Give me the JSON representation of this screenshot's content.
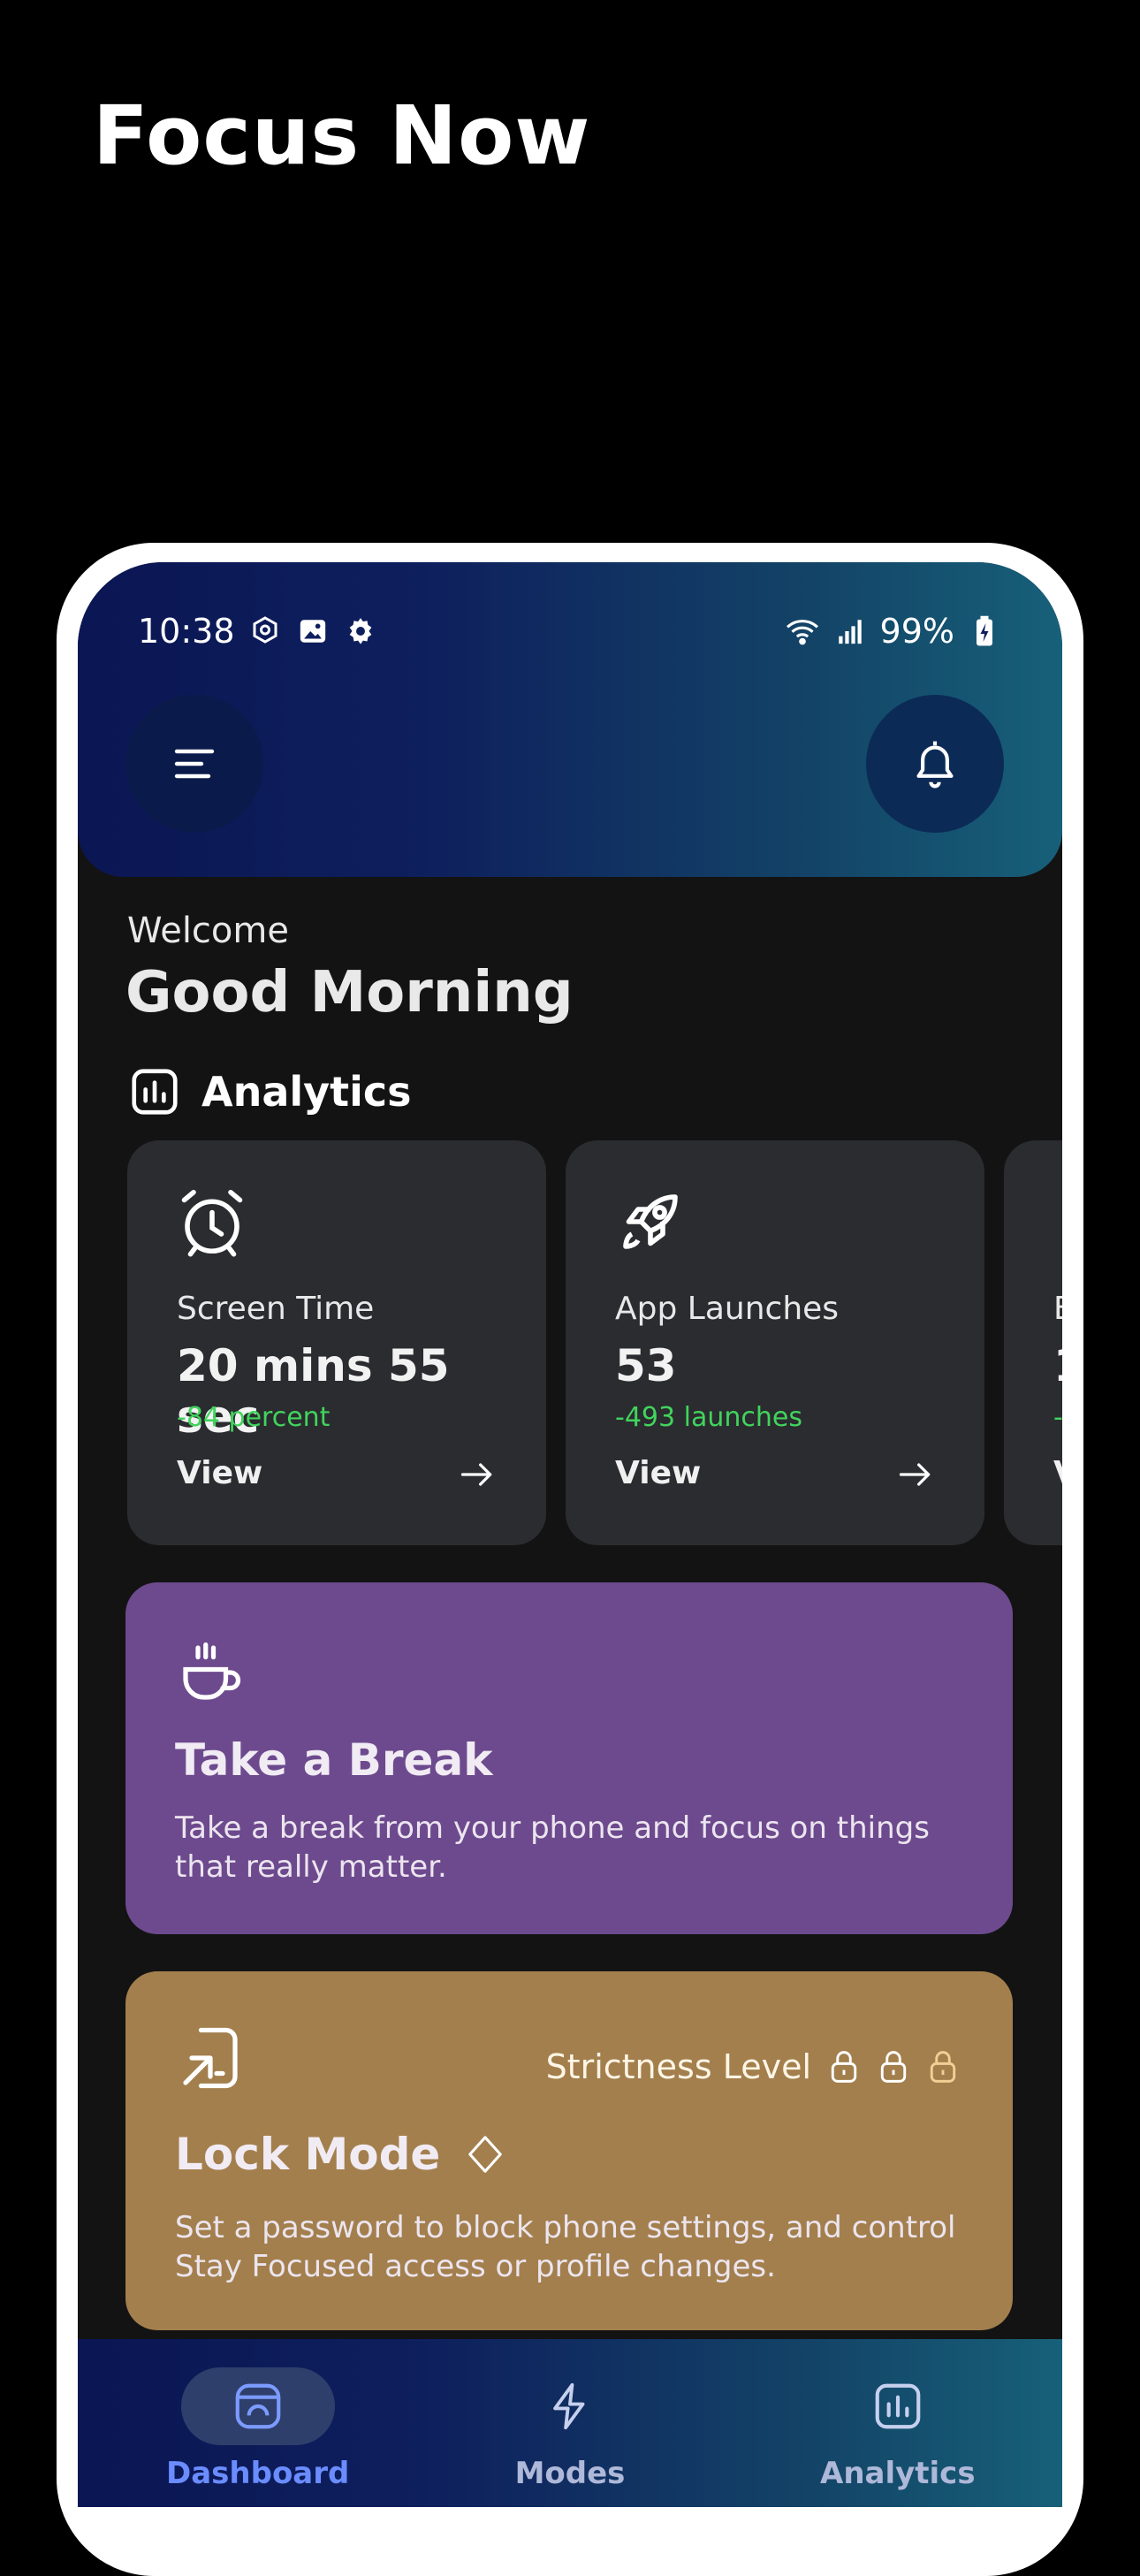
{
  "promo": {
    "title": "Focus Now"
  },
  "status_bar": {
    "time": "10:38",
    "battery": "99%"
  },
  "header": {
    "menu_icon": "menu-icon",
    "notification_icon": "bell-icon"
  },
  "greeting": {
    "welcome": "Welcome",
    "message": "Good Morning"
  },
  "analytics": {
    "title": "Analytics",
    "cards": [
      {
        "icon": "stopwatch-icon",
        "label": "Screen Time",
        "value": "20 mins 55 sec",
        "delta": "-84 percent",
        "view": "View"
      },
      {
        "icon": "rocket-icon",
        "label": "App Launches",
        "value": "53",
        "delta": "-493 launches",
        "view": "View"
      },
      {
        "icon": "phone-icon",
        "label": "B",
        "value": "1",
        "delta": "-",
        "view": "V"
      }
    ]
  },
  "break_card": {
    "icon": "coffee-cup-icon",
    "title": "Take a Break",
    "description": "Take a break from your phone and focus on things that really matter."
  },
  "lock_card": {
    "icon": "lock-mode-icon",
    "title": "Lock Mode",
    "strictness_label": "Strictness Level",
    "description": "Set a password to block phone settings, and control Stay Focused access or profile changes."
  },
  "bottom_nav": {
    "items": [
      {
        "label": "Dashboard",
        "icon": "dashboard-icon",
        "active": true
      },
      {
        "label": "Modes",
        "icon": "lightning-icon",
        "active": false
      },
      {
        "label": "Analytics",
        "icon": "chart-icon",
        "active": false
      }
    ]
  },
  "colors": {
    "header_gradient_start": "#0b1654",
    "header_gradient_end": "#176079",
    "stat_card": "#2b2c30",
    "delta_green": "#41d45c",
    "break_card": "#6d4a8e",
    "lock_card": "#a37f4d"
  }
}
